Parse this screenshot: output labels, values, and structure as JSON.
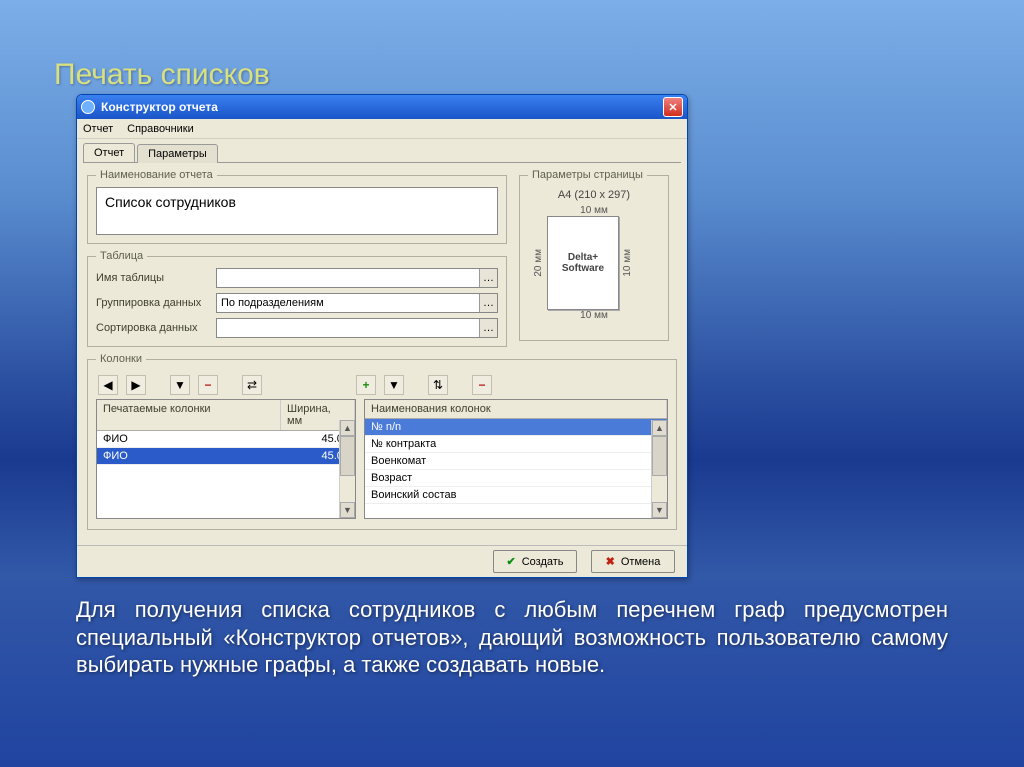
{
  "slide": {
    "title": "Печать списков",
    "description": "Для получения списка сотрудников с любым перечнем граф предусмотрен специальный «Конструктор отчетов», дающий возможность пользователю самому выбирать нужные графы, а также создавать новые."
  },
  "window": {
    "title": "Конструктор отчета",
    "menu": {
      "report": "Отчет",
      "references": "Справочники"
    },
    "tabs": {
      "report": "Отчет",
      "params": "Параметры"
    },
    "report_name_legend": "Наименование отчета",
    "report_name_value": "Список сотрудников",
    "table_legend": "Таблица",
    "labels": {
      "table_name": "Имя таблицы",
      "group_by": "Группировка данных",
      "sort_by": "Сортировка данных"
    },
    "values": {
      "table_name": "",
      "group_by": "По подразделениям",
      "sort_by": ""
    },
    "page_params": {
      "legend": "Параметры страницы",
      "size": "А4 (210 x 297)",
      "margin_top": "10 мм",
      "margin_bottom": "10 мм",
      "margin_left": "20 мм",
      "margin_right": "10 мм",
      "watermark": "Delta+ Software"
    },
    "columns_legend": "Колонки",
    "left_grid": {
      "header_col1": "Печатаемые колонки",
      "header_col2": "Ширина, мм",
      "rows": [
        {
          "name": "ФИО",
          "width": "45.00"
        },
        {
          "name": "ФИО",
          "width": "45.00"
        }
      ]
    },
    "right_grid": {
      "header": "Наименования колонок",
      "rows": [
        "№ n/n",
        "№ контракта",
        "Военкомат",
        "Возраст",
        "Воинский состав"
      ]
    },
    "buttons": {
      "create": "Создать",
      "cancel": "Отмена"
    }
  }
}
